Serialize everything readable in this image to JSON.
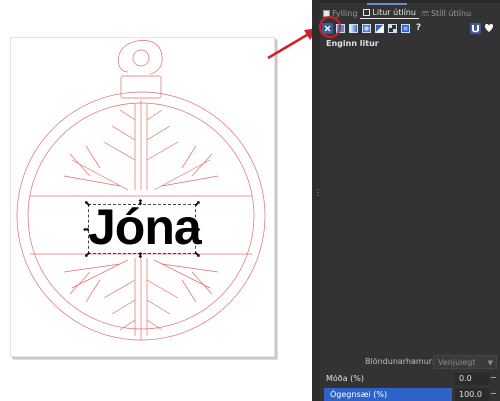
{
  "canvas": {
    "text_object": "Jóna"
  },
  "panel": {
    "tabs": [
      {
        "label": "Fylling",
        "icon": "fill-square-icon"
      },
      {
        "label": "Litur útlínu",
        "icon": "stroke-square-icon"
      },
      {
        "label": "Stíll útlínu",
        "icon": "stroke-style-icon"
      }
    ],
    "active_tab": "Litur útlínu",
    "paint_buttons": [
      "no-paint",
      "flat-color",
      "linear-gradient",
      "radial-gradient",
      "mesh-gradient",
      "pattern",
      "swatch",
      "unset"
    ],
    "paint_unset_symbol": "?",
    "selected_paint": "no-paint",
    "status_text": "Enginn litur",
    "blend_label": "Blöndunarhamur:",
    "blend_value": "Venjulegt",
    "blur_label": "Móða (%)",
    "blur_value": "0.0",
    "opacity_label": "Ógegnsæi (%)",
    "opacity_value": "100.0",
    "opacity_fraction": 1.0
  },
  "colors": {
    "panel_bg": "#333333",
    "outline_red": "#e07070",
    "highlight_red": "#d0202a",
    "accent_blue": "#2d62c8"
  }
}
